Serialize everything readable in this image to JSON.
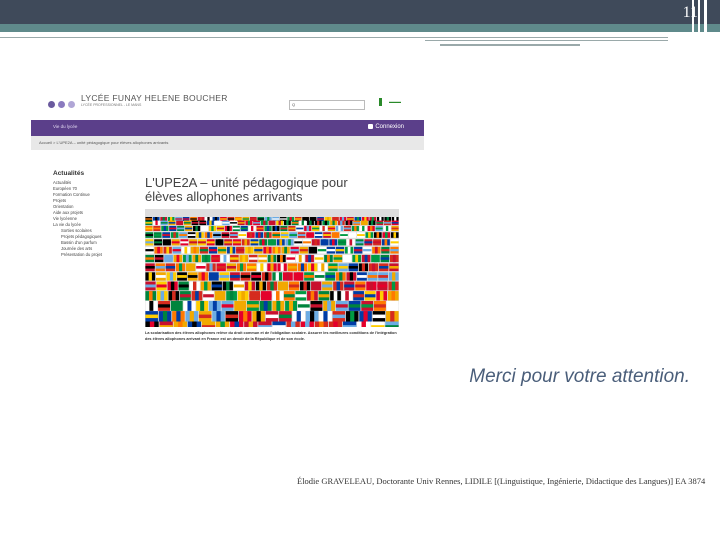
{
  "slide": {
    "page_number": "11",
    "thanks_text": "Merci pour votre attention.",
    "credit_text": "Élodie GRAVELEAU, Doctorante Univ Rennes, LIDILE [(Linguistique, Ingénierie, Didactique des Langues)] EA 3874"
  },
  "website": {
    "site_name": "LYCÉE FUNAY HELENE BOUCHER",
    "site_subtitle": "LYCÉE PROFESSIONNEL - LE MANS",
    "search_value": "Q",
    "login_label": "Connexion",
    "nav_text": "Vie du lycée",
    "breadcrumb": "Accueil > L'UPE2A – unité pédagogique pour élèves allophones arrivants",
    "side_title": "Actualités",
    "side_items": [
      {
        "text": "Actualités",
        "sub": false
      },
      {
        "text": "Européen 70",
        "sub": false
      },
      {
        "text": "Formation Continue",
        "sub": false
      },
      {
        "text": "Projets",
        "sub": false
      },
      {
        "text": "Orientation",
        "sub": false
      },
      {
        "text": "Aide aux projets",
        "sub": false
      },
      {
        "text": "Vie lycéenne",
        "sub": false
      },
      {
        "text": "La vie du lycée",
        "sub": false
      },
      {
        "text": "Sorties scolaires",
        "sub": true
      },
      {
        "text": "Projets pédagogiques",
        "sub": true
      },
      {
        "text": "Bassin d'un parfum",
        "sub": true
      },
      {
        "text": "Journée des arts",
        "sub": true
      },
      {
        "text": "Présentation du projet",
        "sub": true
      }
    ],
    "heading": "L'UPE2A – unité pédagogique pour élèves allophones arrivants",
    "footer_text": "La scolarisation des élèves allophones relève du droit commun et de l'obligation scolaire. Assurer les meilleures conditions de l'intégration des élèves allophones arrivant en France est un devoir de la République et de son école.",
    "logo_colors": [
      "#6a5a9e",
      "#8a7abf",
      "#b0a6d6"
    ]
  }
}
